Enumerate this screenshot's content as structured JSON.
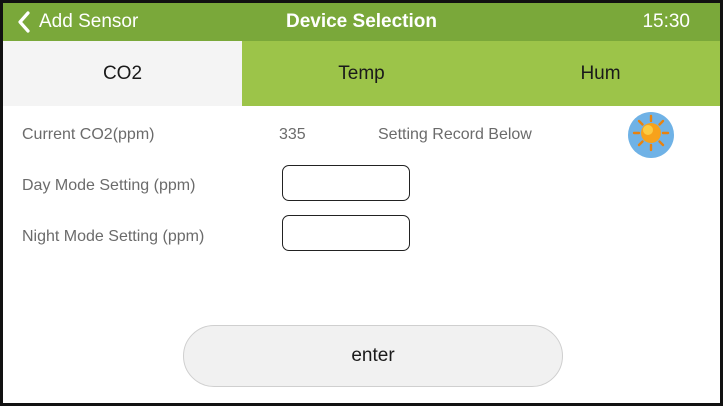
{
  "header": {
    "back_label": "Add Sensor",
    "title": "Device Selection",
    "time": "15:30"
  },
  "tabs": [
    {
      "label": "CO2",
      "active": true
    },
    {
      "label": "Temp",
      "active": false
    },
    {
      "label": "Hum",
      "active": false
    }
  ],
  "status": {
    "current_label": "Current CO2(ppm)",
    "current_value": "335",
    "record_label": "Setting Record Below",
    "mode_icon": "sun-icon"
  },
  "settings": {
    "day_label": "Day Mode Setting (ppm)",
    "day_value": "",
    "night_label": "Night Mode Setting (ppm)",
    "night_value": ""
  },
  "actions": {
    "enter_label": "enter"
  },
  "colors": {
    "header_green": "#7aa83a",
    "tab_green": "#9cc449",
    "active_tab": "#f4f4f4",
    "sun_badge": "#6fb2e6"
  }
}
